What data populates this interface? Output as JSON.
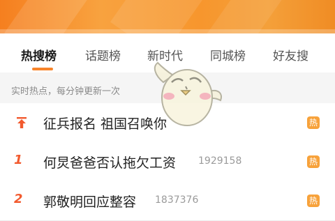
{
  "tabs": [
    {
      "label": "热搜榜",
      "active": true
    },
    {
      "label": "话题榜",
      "active": false
    },
    {
      "label": "新时代",
      "active": false
    },
    {
      "label": "同城榜",
      "active": false
    },
    {
      "label": "好友搜",
      "active": false
    }
  ],
  "subheader": "实时热点，每分钟更新一次",
  "rows": [
    {
      "rank": "",
      "pinned": true,
      "title": "征兵报名 祖国召唤你",
      "count": "",
      "badge": "热"
    },
    {
      "rank": "1",
      "title": "何炅爸爸否认拖欠工资",
      "count": "1929158",
      "badge": "热"
    },
    {
      "rank": "2",
      "title": "郭敬明回应整容",
      "count": "1837376",
      "badge": "热"
    }
  ],
  "colors": {
    "accent": "#f7842a",
    "rank": "#f25a2e",
    "badge": "#f7a23b"
  }
}
